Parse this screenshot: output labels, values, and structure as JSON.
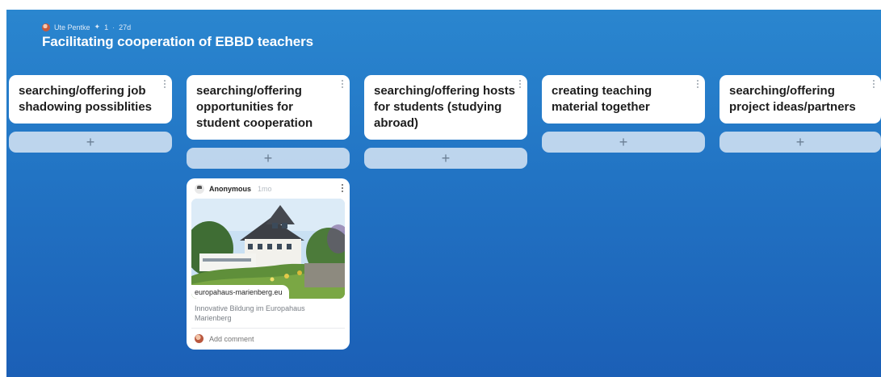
{
  "board": {
    "author": "Ute Pentke",
    "reactions": "1",
    "age": "27d",
    "title": "Facilitating cooperation of EBBD teachers",
    "gradient_top": "#2a86cf",
    "gradient_bottom": "#1b5fb6"
  },
  "columns": [
    {
      "title": "searching/offering job shadowing possiblities",
      "add_label": "+"
    },
    {
      "title": "searching/offering opportunities for student cooperation",
      "add_label": "+"
    },
    {
      "title": "searching/offering hosts for students (studying abroad)",
      "add_label": "+"
    },
    {
      "title": "creating teaching material together",
      "add_label": "+"
    },
    {
      "title": "searching/offering project ideas/partners",
      "add_label": "+"
    }
  ],
  "post": {
    "author": "Anonymous",
    "time": "1mo",
    "link_domain": "europahaus-marienberg.eu",
    "link_description": "Innovative Bildung im Europahaus Marienberg",
    "comment_placeholder": "Add comment",
    "image_subject": "building-photo"
  },
  "icons": {
    "author_avatar": "user-avatar-icon",
    "reaction": "star-icon",
    "column_menu": "kebab-menu-icon",
    "add": "plus-icon",
    "anonymous_avatar": "anonymous-avatar-icon",
    "comment_avatar": "user-avatar-icon"
  }
}
